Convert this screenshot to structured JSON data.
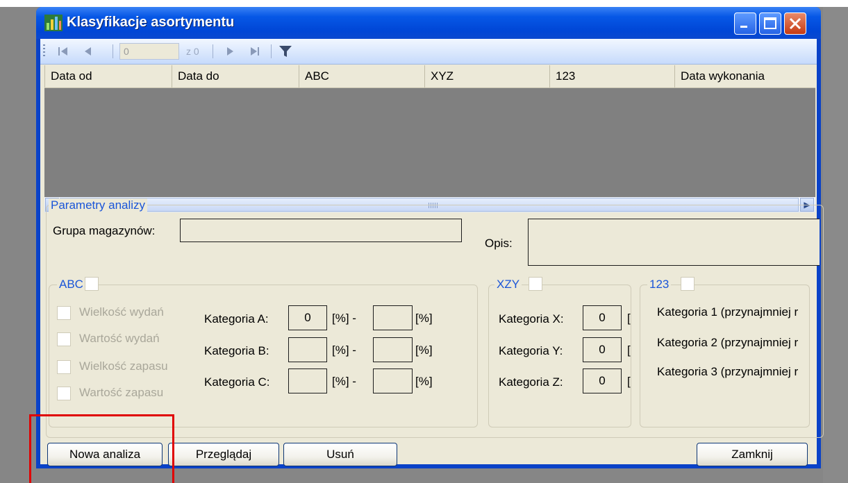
{
  "window": {
    "title": "Klasyfikacje asortymentu"
  },
  "navigator": {
    "position_value": "0",
    "count_label": "z 0"
  },
  "grid": {
    "columns": [
      "Data od",
      "Data do",
      "ABC",
      "XYZ",
      "123",
      "Data wykonania"
    ],
    "rows": []
  },
  "params": {
    "group_title": "Parametry analizy",
    "grupa_label": "Grupa magazynów:",
    "grupa_value": "",
    "opis_label": "Opis:",
    "opis_value": ""
  },
  "abc": {
    "title": "ABC",
    "options": [
      "Wielkość wydań",
      "Wartość wydań",
      "Wielkość zapasu",
      "Wartość zapasu"
    ],
    "categories": [
      {
        "label": "Kategoria A:",
        "from": "0",
        "unit1": "[%] -",
        "to": "",
        "unit2": "[%]"
      },
      {
        "label": "Kategoria B:",
        "from": "",
        "unit1": "[%] -",
        "to": "",
        "unit2": "[%]"
      },
      {
        "label": "Kategoria C:",
        "from": "",
        "unit1": "[%] -",
        "to": "",
        "unit2": "[%]"
      }
    ]
  },
  "xzy": {
    "title": "XZY",
    "categories": [
      {
        "label": "Kategoria X:",
        "value": "0",
        "unit": "[:"
      },
      {
        "label": "Kategoria Y:",
        "value": "0",
        "unit": "[:"
      },
      {
        "label": "Kategoria Z:",
        "value": "0",
        "unit": "[:"
      }
    ]
  },
  "n123": {
    "title": "123",
    "categories": [
      "Kategoria 1 (przynajmniej r",
      "Kategoria 2 (przynajmniej r",
      "Kategoria 3 (przynajmniej r"
    ]
  },
  "buttons": {
    "new": "Nowa analiza",
    "browse": "Przeglądaj",
    "delete": "Usuń",
    "close": "Zamknij"
  },
  "colors": {
    "titlebar": "#0046d6",
    "dialog_bg": "#ece9d8",
    "group_title": "#1a55d8",
    "highlight": "#e00000"
  }
}
